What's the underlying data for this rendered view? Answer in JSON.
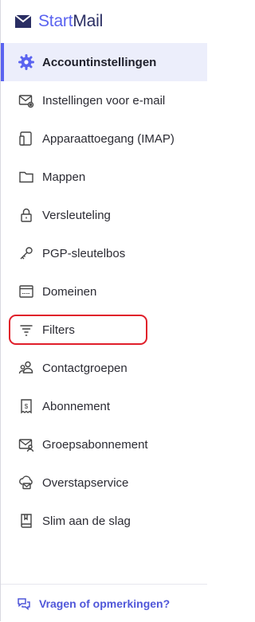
{
  "brand": {
    "start": "Start",
    "mail": "Mail"
  },
  "menu": {
    "items": [
      {
        "label": "Accountinstellingen",
        "icon": "gear-icon",
        "active": true
      },
      {
        "label": "Instellingen voor e-mail",
        "icon": "mail-settings-icon"
      },
      {
        "label": "Apparaattoegang (IMAP)",
        "icon": "devices-icon"
      },
      {
        "label": "Mappen",
        "icon": "folder-icon"
      },
      {
        "label": "Versleuteling",
        "icon": "lock-icon"
      },
      {
        "label": "PGP-sleutelbos",
        "icon": "key-icon"
      },
      {
        "label": "Domeinen",
        "icon": "domain-icon"
      },
      {
        "label": "Filters",
        "icon": "filter-icon",
        "highlighted": true
      },
      {
        "label": "Contactgroepen",
        "icon": "contacts-icon"
      },
      {
        "label": "Abonnement",
        "icon": "subscription-icon"
      },
      {
        "label": "Groepsabonnement",
        "icon": "group-subscription-icon"
      },
      {
        "label": "Overstapservice",
        "icon": "migration-icon"
      },
      {
        "label": "Slim aan de slag",
        "icon": "book-icon"
      }
    ]
  },
  "footer": {
    "label": "Vragen of opmerkingen?",
    "icon": "chat-icon"
  },
  "colors": {
    "accent": "#5a63f0",
    "brand_dark": "#2a2e63",
    "highlight": "#e01e2a",
    "active_bg": "#eceefb"
  }
}
